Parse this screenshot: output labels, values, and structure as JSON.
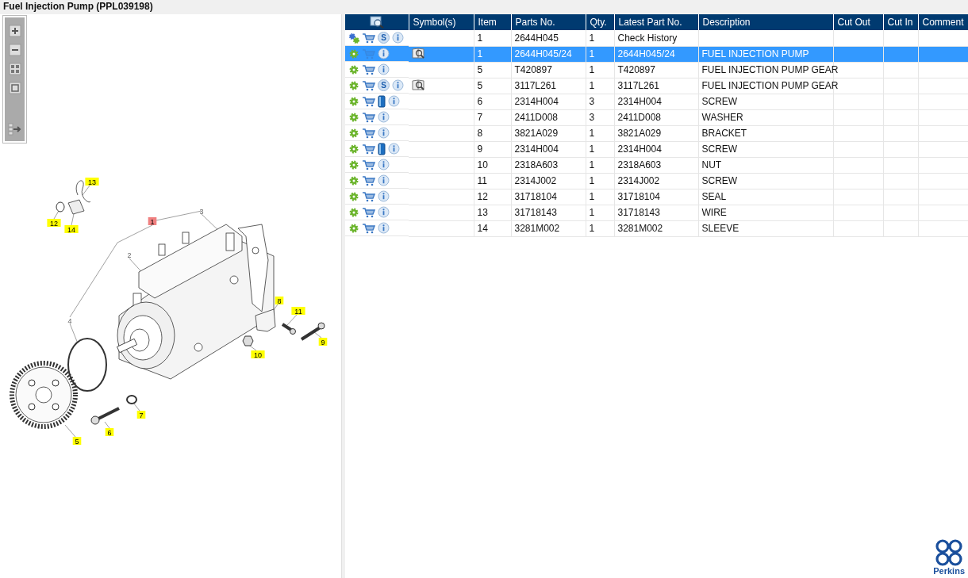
{
  "window": {
    "title": "Fuel Injection Pump (PPL039198)"
  },
  "toolbar": {
    "buttons": [
      {
        "kind": "zoom_in"
      },
      {
        "kind": "zoom_out"
      },
      {
        "kind": "fit"
      },
      {
        "kind": "actual"
      },
      {
        "kind": "panel"
      }
    ]
  },
  "diagram": {
    "callouts": [
      {
        "label": "13",
        "kind": "boxed",
        "selected": false
      },
      {
        "label": "12",
        "kind": "boxed",
        "selected": false
      },
      {
        "label": "14",
        "kind": "boxed",
        "selected": false
      },
      {
        "label": "1",
        "kind": "boxed",
        "selected": true
      },
      {
        "label": "3",
        "kind": "plain",
        "selected": false
      },
      {
        "label": "2",
        "kind": "plain",
        "selected": false
      },
      {
        "label": "4",
        "kind": "plain",
        "selected": false
      },
      {
        "label": "8",
        "kind": "boxed",
        "selected": false
      },
      {
        "label": "11",
        "kind": "boxed",
        "selected": false
      },
      {
        "label": "9",
        "kind": "boxed",
        "selected": false
      },
      {
        "label": "10",
        "kind": "boxed",
        "selected": false
      },
      {
        "label": "7",
        "kind": "boxed",
        "selected": false
      },
      {
        "label": "6",
        "kind": "boxed",
        "selected": false
      },
      {
        "label": "5",
        "kind": "boxed",
        "selected": false
      }
    ]
  },
  "table": {
    "columns": [
      "Symbol(s)",
      "Item",
      "Parts No.",
      "Qty.",
      "Latest Part No.",
      "Description",
      "Cut Out",
      "Cut In",
      "Comment"
    ],
    "rows": [
      {
        "kind": "history",
        "service_badge": "S",
        "manual": false,
        "preview": false,
        "selected": false,
        "item": "1",
        "part_no": "2644H045",
        "qty": "1",
        "latest": "Check History",
        "description": ""
      },
      {
        "kind": "part",
        "manual": false,
        "preview": true,
        "selected": true,
        "item": "1",
        "part_no": "2644H045/24",
        "qty": "1",
        "latest": "2644H045/24",
        "description": "FUEL INJECTION PUMP"
      },
      {
        "kind": "part",
        "manual": false,
        "preview": false,
        "selected": false,
        "item": "5",
        "part_no": "T420897",
        "qty": "1",
        "latest": "T420897",
        "description": "FUEL INJECTION PUMP GEAR"
      },
      {
        "kind": "part",
        "service_badge": "S",
        "manual": false,
        "preview": true,
        "selected": false,
        "item": "5",
        "part_no": "3117L261",
        "qty": "1",
        "latest": "3117L261",
        "description": "FUEL INJECTION PUMP GEAR"
      },
      {
        "kind": "part",
        "manual": true,
        "preview": false,
        "selected": false,
        "item": "6",
        "part_no": "2314H004",
        "qty": "3",
        "latest": "2314H004",
        "description": "SCREW"
      },
      {
        "kind": "part",
        "manual": false,
        "preview": false,
        "selected": false,
        "item": "7",
        "part_no": "2411D008",
        "qty": "3",
        "latest": "2411D008",
        "description": "WASHER"
      },
      {
        "kind": "part",
        "manual": false,
        "preview": false,
        "selected": false,
        "item": "8",
        "part_no": "3821A029",
        "qty": "1",
        "latest": "3821A029",
        "description": "BRACKET"
      },
      {
        "kind": "part",
        "manual": true,
        "preview": false,
        "selected": false,
        "item": "9",
        "part_no": "2314H004",
        "qty": "1",
        "latest": "2314H004",
        "description": "SCREW"
      },
      {
        "kind": "part",
        "manual": false,
        "preview": false,
        "selected": false,
        "item": "10",
        "part_no": "2318A603",
        "qty": "1",
        "latest": "2318A603",
        "description": "NUT"
      },
      {
        "kind": "part",
        "manual": false,
        "preview": false,
        "selected": false,
        "item": "11",
        "part_no": "2314J002",
        "qty": "1",
        "latest": "2314J002",
        "description": "SCREW"
      },
      {
        "kind": "part",
        "manual": false,
        "preview": false,
        "selected": false,
        "item": "12",
        "part_no": "31718104",
        "qty": "1",
        "latest": "31718104",
        "description": "SEAL"
      },
      {
        "kind": "part",
        "manual": false,
        "preview": false,
        "selected": false,
        "item": "13",
        "part_no": "31718143",
        "qty": "1",
        "latest": "31718143",
        "description": "WIRE"
      },
      {
        "kind": "part",
        "manual": false,
        "preview": false,
        "selected": false,
        "item": "14",
        "part_no": "3281M002",
        "qty": "1",
        "latest": "3281M002",
        "description": "SLEEVE"
      }
    ]
  },
  "logo": {
    "text": "Perkins"
  }
}
